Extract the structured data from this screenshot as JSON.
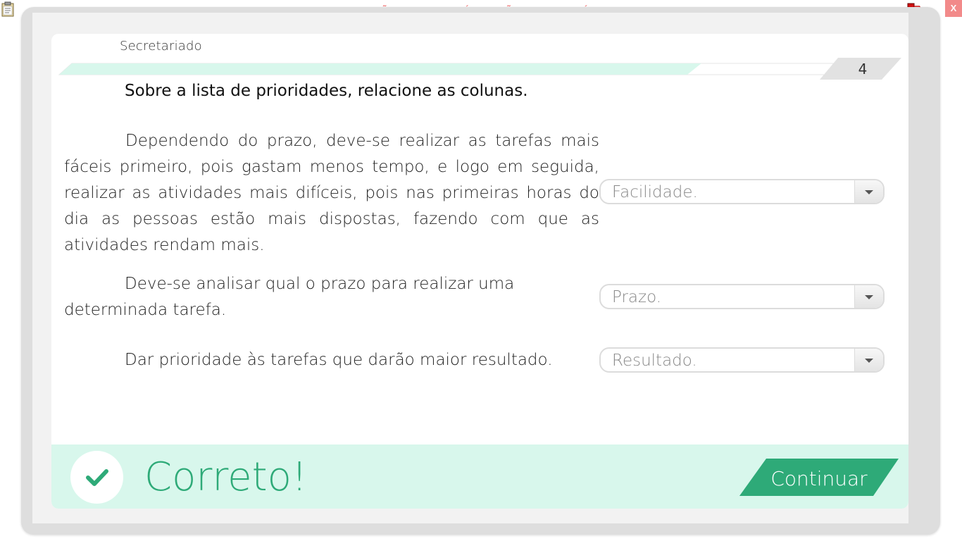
{
  "window": {
    "banner": "VERSÃO PARA FUNCIONÁRIOS - NÃO COMERCIALIZÁVEL",
    "close_label": "X"
  },
  "lesson": {
    "module": "Secretariado",
    "page_number": "4",
    "progress_fraction": 0.82
  },
  "question": {
    "title": "Sobre a lista de prioridades, relacione as colunas.",
    "items": [
      {
        "text": "Dependendo do prazo, deve-se realizar as tarefas mais fáceis primeiro, pois gastam menos tempo, e logo em seguida, realizar as atividades mais difíceis, pois nas primeiras horas do dia as pessoas estão mais dispostas, fazendo com que as atividades rendam mais.",
        "selected": "Facilidade."
      },
      {
        "text": "Deve-se analisar qual o prazo para realizar uma determinada tarefa.",
        "selected": "Prazo."
      },
      {
        "text": "Dar prioridade às tarefas que darão maior resultado.",
        "selected": "Resultado."
      }
    ]
  },
  "feedback": {
    "message": "Correto!",
    "continue_label": "Continuar"
  },
  "colors": {
    "accent_green": "#2eaa78",
    "feedback_bg": "#d8f7ec",
    "progress_fill": "#d8f7ec",
    "banner_red": "#f06a6a"
  },
  "icons": {
    "top_left": "clipboard-icon",
    "top_right": "network-status-icon",
    "feedback": "checkmark-icon",
    "select_arrow": "chevron-down-icon"
  }
}
